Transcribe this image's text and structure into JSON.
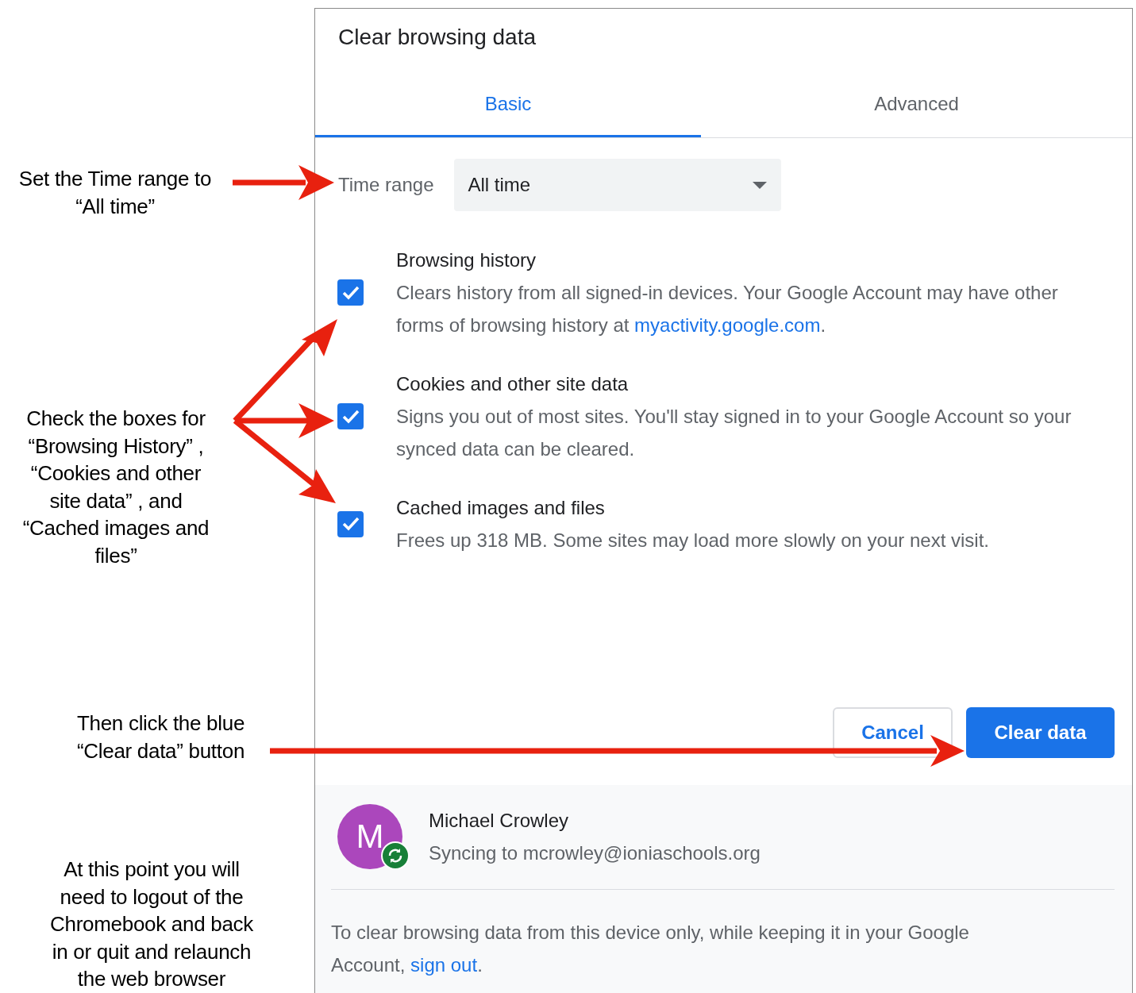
{
  "annotations": [
    {
      "lines": [
        "Set the Time range to",
        "“All time”"
      ]
    },
    {
      "lines": [
        "Check the boxes for",
        "“Browsing History” ,",
        "“Cookies and other",
        "site data” , and",
        "“Cached images and",
        "files”"
      ]
    },
    {
      "lines": [
        "Then click the blue",
        "“Clear data” button"
      ]
    },
    {
      "lines": [
        "At this point you will",
        "need to logout of the",
        "Chromebook and back",
        "in or quit and relaunch",
        "the web browser"
      ]
    }
  ],
  "dialog": {
    "title": "Clear browsing data",
    "tabs": [
      {
        "label": "Basic",
        "selected": true
      },
      {
        "label": "Advanced",
        "selected": false
      }
    ],
    "time_range": {
      "label": "Time range",
      "value": "All time"
    },
    "options": [
      {
        "title": "Browsing history",
        "checked": true,
        "description": "Clears history from all signed-in devices. Your Google Account may have other forms of browsing history at ",
        "link": "myactivity.google.com",
        "after": "."
      },
      {
        "title": "Cookies and other site data",
        "checked": true,
        "description": "Signs you out of most sites. You'll stay signed in to your Google Account so your synced data can be cleared."
      },
      {
        "title": "Cached images and files",
        "checked": true,
        "description": "Frees up 318 MB. Some sites may load more slowly on your next visit."
      }
    ],
    "buttons": [
      {
        "label": "Cancel",
        "kind": "secondary"
      },
      {
        "label": "Clear data",
        "kind": "primary"
      }
    ],
    "account": {
      "initial": "M",
      "name": "Michael Crowley",
      "status": "Syncing to mcrowley@ioniaschools.org"
    },
    "note": {
      "text": "To clear browsing data from this device only, while keeping it in your Google Account, ",
      "link": "sign out",
      "after": "."
    }
  }
}
